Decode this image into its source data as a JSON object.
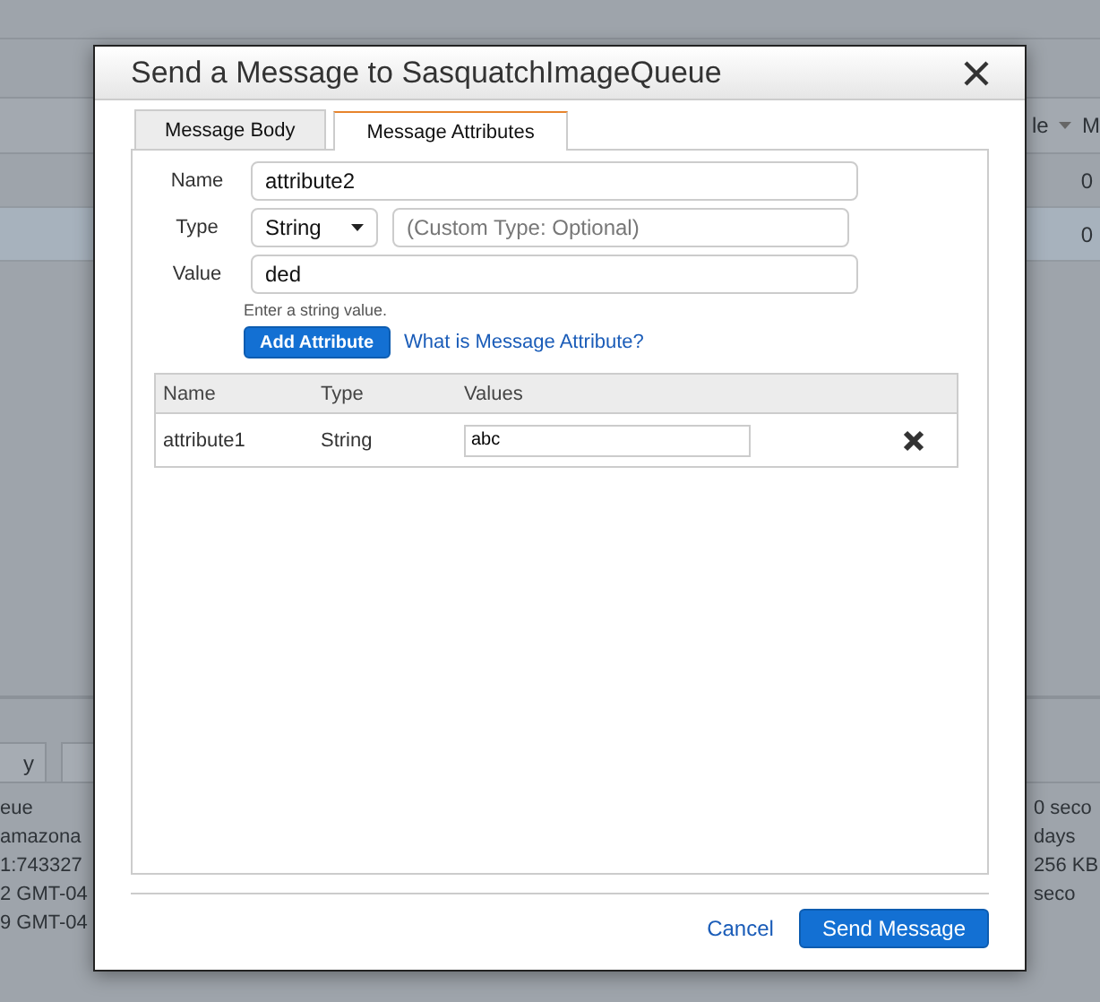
{
  "background": {
    "header_cells": [
      "le",
      "M"
    ],
    "rows": [
      {
        "value": "0",
        "selected": false
      },
      {
        "value": "0",
        "selected": true
      }
    ],
    "detail_tabs": [
      "y"
    ],
    "details_left": [
      "eue",
      "amazona",
      "1:743327",
      "2 GMT-04",
      "9 GMT-04"
    ],
    "details_right": [
      "0 seco",
      "days",
      "256 KB",
      "seco"
    ]
  },
  "dialog": {
    "title": "Send a Message to SasquatchImageQueue",
    "tabs": [
      {
        "label": "Message Body",
        "selected": false
      },
      {
        "label": "Message Attributes",
        "selected": true
      }
    ],
    "form": {
      "name_label": "Name",
      "name_value": "attribute2",
      "type_label": "Type",
      "type_value": "String",
      "custom_type_placeholder": "(Custom Type: Optional)",
      "value_label": "Value",
      "value": "ded",
      "hint": "Enter a string value.",
      "add_button": "Add Attribute",
      "help_link": "What is Message Attribute?"
    },
    "table": {
      "columns": [
        "Name",
        "Type",
        "Values"
      ],
      "rows": [
        {
          "name": "attribute1",
          "type": "String",
          "value": "abc"
        }
      ]
    },
    "buttons": {
      "cancel": "Cancel",
      "send": "Send Message"
    }
  }
}
